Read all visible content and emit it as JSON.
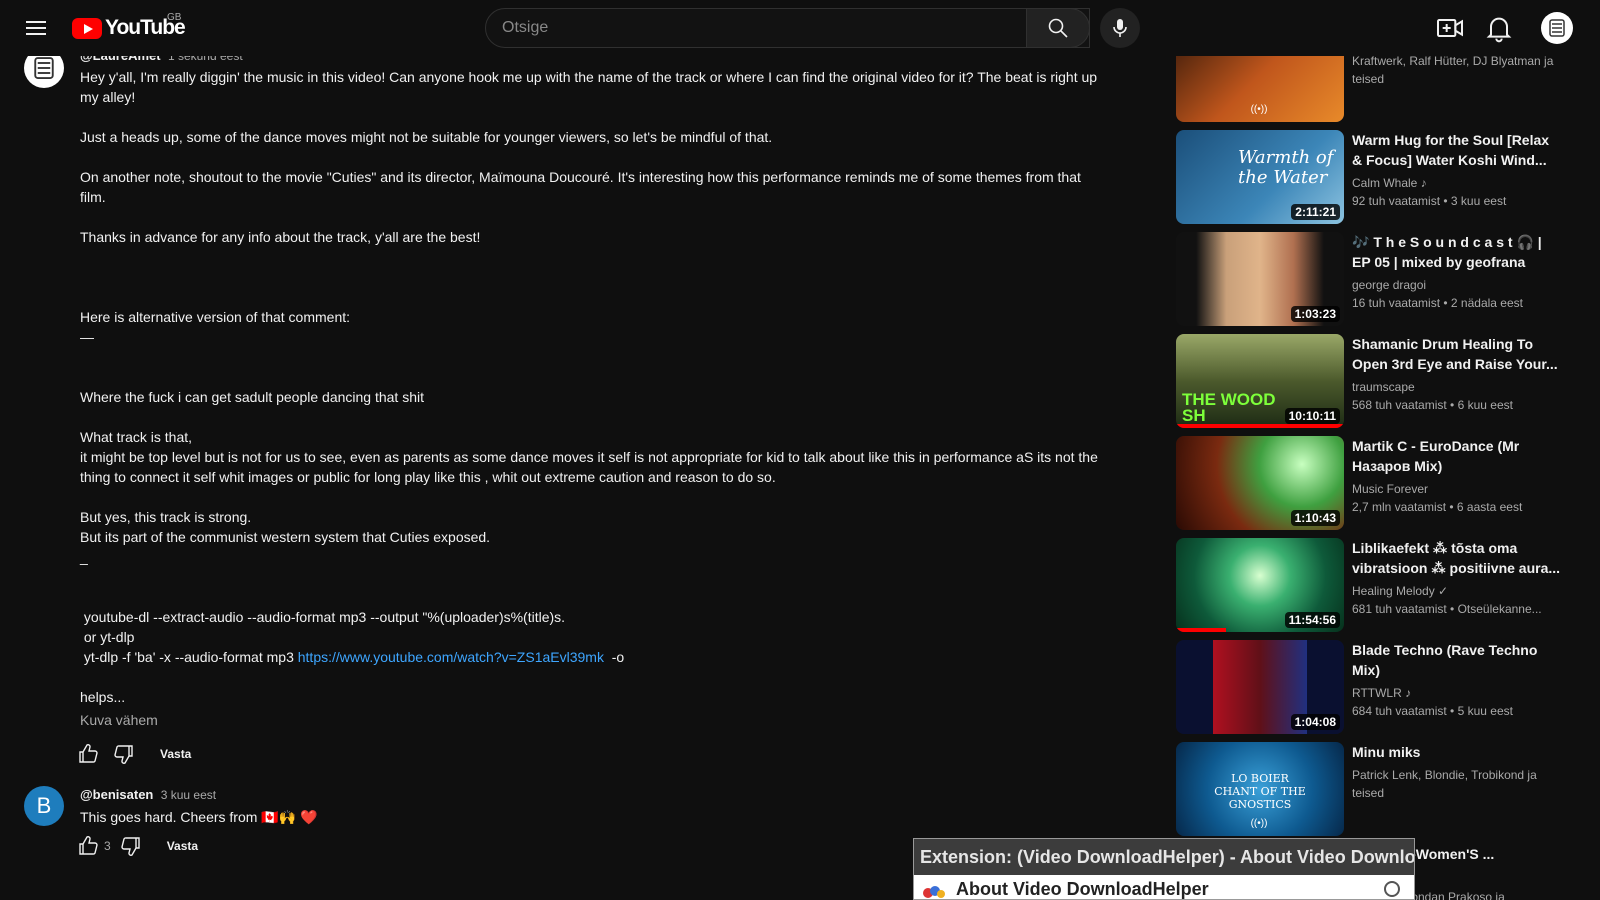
{
  "header": {
    "logo_text": "YouTube",
    "region": "GB",
    "search_placeholder": "Otsige"
  },
  "comments": [
    {
      "author": "@LaureAmet",
      "time": "1 sekund eest",
      "body": "Hey y'all, I'm really diggin' the music in this video! Can anyone hook me up with the name of the track or where I can find the original video for it? The beat is right up\nmy alley!\n\nJust a heads up, some of the dance moves might not be suitable for younger viewers, so let's be mindful of that.\n\nOn another note, shoutout to the movie \"Cuties\" and its director, Maïmouna Doucouré. It's interesting how this performance reminds me of some themes from that\nfilm.\n\nThanks in advance for any info about the track, y'all are the best!\n\n\n\nHere is alternative version of that comment:\n—\n\n\nWhere the fuck i can get sadult people dancing that shit\n\nWhat track is that,\nit might be top level but is not for us to see, even as parents as some dance moves it self is not appropriate for kid to talk about like this in performance aS its not the\nthing to connect it self whit images or public for long play like this , whit out extreme caution and reason to do so.\n\nBut yes, this track is strong.\nBut its part of the communist western system that Cuties exposed.\n_\n\n\n youtube-dl --extract-audio --audio-format mp3 --output \"%(uploader)s%(title)s.\n or yt-dlp\n yt-dlp -f 'ba' -x --audio-format mp3 ",
      "link": "https://www.youtube.com/watch?v=ZS1aEvl39mk",
      "body_after_link": "  -o\n\nhelps...",
      "show_less": "Kuva vähem",
      "likes": "",
      "reply": "Vasta"
    },
    {
      "author": "@benisaten",
      "avatar_letter": "B",
      "time": "3 kuu eest",
      "body": "This goes hard. Cheers from 🇨🇦🙌 ❤️",
      "likes": "3",
      "reply": "Vasta"
    }
  ],
  "recommendations": [
    {
      "title": "",
      "channel": "Kraftwerk, Ralf Hütter, DJ Blyatman ja teised",
      "meta": "",
      "duration": "",
      "live": true
    },
    {
      "title": "Warm Hug for the Soul [Relax & Focus] Water Koshi Wind...",
      "channel": "Calm Whale ♪",
      "meta": "92 tuh vaatamist • 3 kuu eest",
      "duration": "2:11:21",
      "thumb_text": "Warmth of the Water"
    },
    {
      "title": "🎶 T h e S o u n d c a s t 🎧 | EP 05 | mixed by geofrana",
      "channel": "george dragoi",
      "meta": "16 tuh vaatamist • 2 nädala eest",
      "duration": "1:03:23"
    },
    {
      "title": "Shamanic Drum Healing To Open 3rd Eye and Raise Your...",
      "channel": "traumscape",
      "meta": "568 tuh vaatamist • 6 kuu eest",
      "duration": "10:10:11",
      "thumb_text": "THE WOOD SH",
      "progress": 100
    },
    {
      "title": "Martik C - EuroDance (Mr Назаров Mix)",
      "channel": "Music Forever",
      "meta": "2,7 mln vaatamist • 6 aasta eest",
      "duration": "1:10:43"
    },
    {
      "title": "Liblikaefekt ⁂ tõsta oma vibratsioon ⁂ positiivne aura...",
      "channel": "Healing Melody ✓",
      "meta": "681 tuh vaatamist • Otseülekanne...",
      "duration": "11:54:56",
      "progress": 30
    },
    {
      "title": "Blade Techno (Rave Techno Mix)",
      "channel": "RTTWLR ♪",
      "meta": "684 tuh vaatamist • 5 kuu eest",
      "duration": "1:04:08"
    },
    {
      "title": "Minu miks",
      "channel": "Patrick Lenk, Blondie, Trobikond ja teised",
      "meta": "",
      "duration": "",
      "live": true,
      "thumb_text": "LO BOIER CHANT OF THE GNOSTICS"
    },
    {
      "title": "Martik C -Women'S ...",
      "channel": "Martik C, Bondan Prakoso ja",
      "meta": "",
      "duration": ""
    }
  ],
  "extension": {
    "header": "Extension: (Video DownloadHelper) - About Video Downlo",
    "title": "About Video DownloadHelper"
  },
  "colors": {
    "background": "#0f0f0f",
    "link": "#3ea6ff",
    "brand_red": "#ff0000"
  }
}
